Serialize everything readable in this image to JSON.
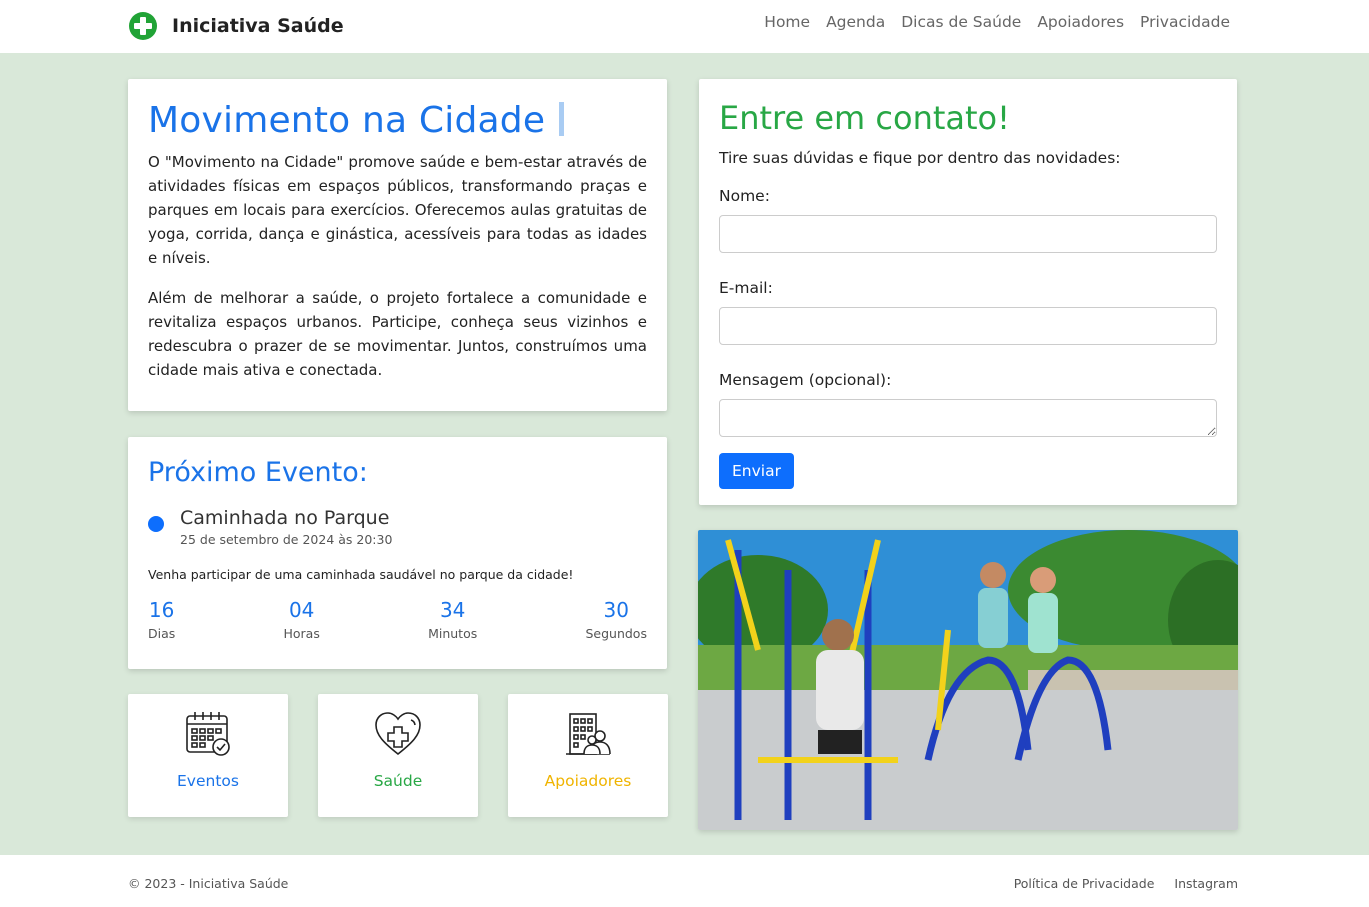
{
  "header": {
    "brand": "Iniciativa Saúde",
    "nav": [
      "Home",
      "Agenda",
      "Dicas de Saúde",
      "Apoiadores",
      "Privacidade"
    ]
  },
  "about": {
    "title": "Movimento na Cidade",
    "paragraph1": "O \"Movimento na Cidade\" promove saúde e bem-estar através de atividades físicas em espaços públicos, transformando praças e parques em locais para exercícios. Oferecemos aulas gratuitas de yoga, corrida, dança e ginástica, acessíveis para todas as idades e níveis.",
    "paragraph2": "Além de melhorar a saúde, o projeto fortalece a comunidade e revitaliza espaços urbanos. Participe, conheça seus vizinhos e redescubra o prazer de se movimentar. Juntos, construímos uma cidade mais ativa e conectada."
  },
  "event": {
    "heading": "Próximo Evento:",
    "name": "Caminhada no Parque",
    "date": "25 de setembro de 2024 às 20:30",
    "description": "Venha participar de uma caminhada saudável no parque da cidade!",
    "countdown": [
      {
        "value": "16",
        "label": "Dias"
      },
      {
        "value": "04",
        "label": "Horas"
      },
      {
        "value": "34",
        "label": "Minutos"
      },
      {
        "value": "30",
        "label": "Segundos"
      }
    ]
  },
  "tiles": [
    {
      "label": "Eventos",
      "icon": "calendar-check-icon",
      "color": "#1a73e8"
    },
    {
      "label": "Saúde",
      "icon": "heart-cross-icon",
      "color": "#28a745"
    },
    {
      "label": "Apoiadores",
      "icon": "building-people-icon",
      "color": "#f0b400"
    }
  ],
  "contact": {
    "title": "Entre em contato!",
    "intro": "Tire suas dúvidas e fique por dentro das novidades:",
    "name_label": "Nome:",
    "email_label": "E-mail:",
    "message_label": "Mensagem (opcional):",
    "name_value": "",
    "email_value": "",
    "message_value": "",
    "submit": "Enviar"
  },
  "colors": {
    "accent_blue": "#1a73e8",
    "accent_green": "#28a745",
    "accent_yellow": "#f0b400",
    "button_blue": "#0d6efd",
    "page_background": "#d9e8d9"
  },
  "footer": {
    "copyright": "© 2023 - Iniciativa Saúde",
    "links": [
      "Política de Privacidade",
      "Instagram"
    ]
  }
}
